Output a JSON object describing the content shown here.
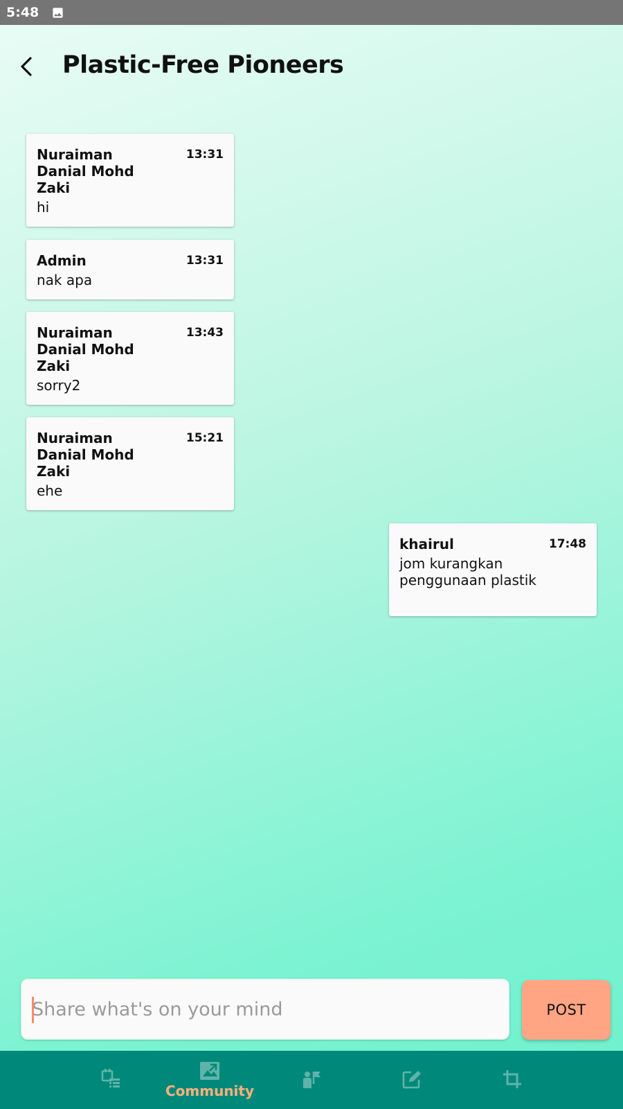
{
  "status_bar": {
    "time": "5:48"
  },
  "header": {
    "title": "Plastic-Free Pioneers"
  },
  "messages": [
    {
      "name": "Nuraiman Danial Mohd Zaki",
      "time": "13:31",
      "text": "hi"
    },
    {
      "name": "Admin",
      "time": "13:31",
      "text": "nak apa"
    },
    {
      "name": "Nuraiman Danial Mohd Zaki",
      "time": "13:43",
      "text": "sorry2"
    },
    {
      "name": "Nuraiman Danial Mohd Zaki",
      "time": "15:21",
      "text": "ehe"
    },
    {
      "name": "khairul",
      "time": "17:48",
      "text": "jom kurangkan penggunaan plastik"
    }
  ],
  "composer": {
    "placeholder": "Share what's on your mind",
    "value": ""
  },
  "post_label": "POST",
  "bottom_nav": {
    "items": [
      {
        "icon": "schedule-list-icon",
        "label": ""
      },
      {
        "icon": "community-image-icon",
        "label": "Community"
      },
      {
        "icon": "people-flag-icon",
        "label": ""
      },
      {
        "icon": "edit-share-icon",
        "label": ""
      },
      {
        "icon": "crop-icon",
        "label": ""
      }
    ],
    "active_color": "#ffb07a",
    "inactive_color": "#5fb3a8",
    "background": "#00897b"
  }
}
